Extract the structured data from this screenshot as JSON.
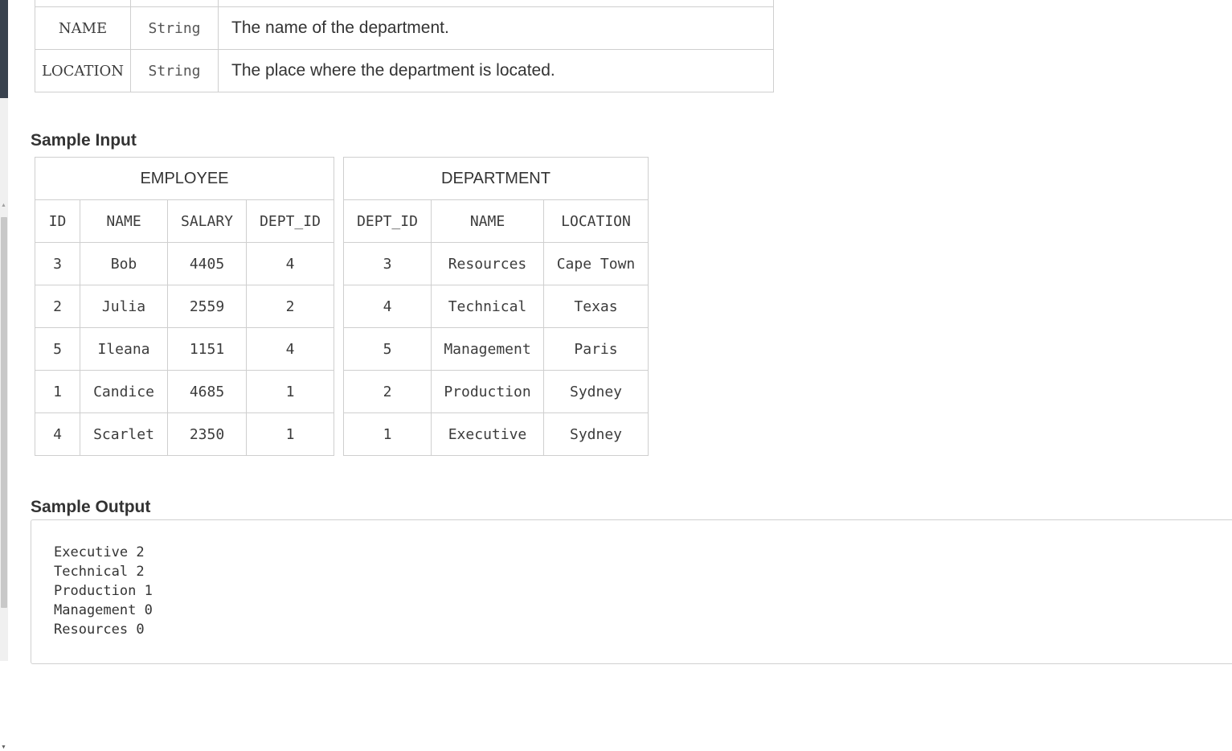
{
  "description_table": {
    "rows": [
      {
        "col": "",
        "type": "",
        "desc": ""
      },
      {
        "col": "NAME",
        "type": "String",
        "desc": "The name of the department."
      },
      {
        "col": "LOCATION",
        "type": "String",
        "desc": "The place where the department is located."
      }
    ]
  },
  "sample_input": {
    "title": "Sample Input",
    "employee": {
      "caption": "EMPLOYEE",
      "headers": [
        "ID",
        "NAME",
        "SALARY",
        "DEPT_ID"
      ],
      "rows": [
        [
          "3",
          "Bob",
          "4405",
          "4"
        ],
        [
          "2",
          "Julia",
          "2559",
          "2"
        ],
        [
          "5",
          "Ileana",
          "1151",
          "4"
        ],
        [
          "1",
          "Candice",
          "4685",
          "1"
        ],
        [
          "4",
          "Scarlet",
          "2350",
          "1"
        ]
      ]
    },
    "department": {
      "caption": "DEPARTMENT",
      "headers": [
        "DEPT_ID",
        "NAME",
        "LOCATION"
      ],
      "rows": [
        [
          "3",
          "Resources",
          "Cape Town"
        ],
        [
          "4",
          "Technical",
          "Texas"
        ],
        [
          "5",
          "Management",
          "Paris"
        ],
        [
          "2",
          "Production",
          "Sydney"
        ],
        [
          "1",
          "Executive",
          "Sydney"
        ]
      ]
    }
  },
  "sample_output": {
    "title": "Sample Output",
    "lines": [
      "Executive 2",
      "Technical 2",
      "Production 1",
      "Management 0",
      "Resources 0"
    ]
  },
  "colors": {
    "sidebar": "#39424e",
    "border": "#cfcfcf",
    "text": "#3c3c3c"
  }
}
